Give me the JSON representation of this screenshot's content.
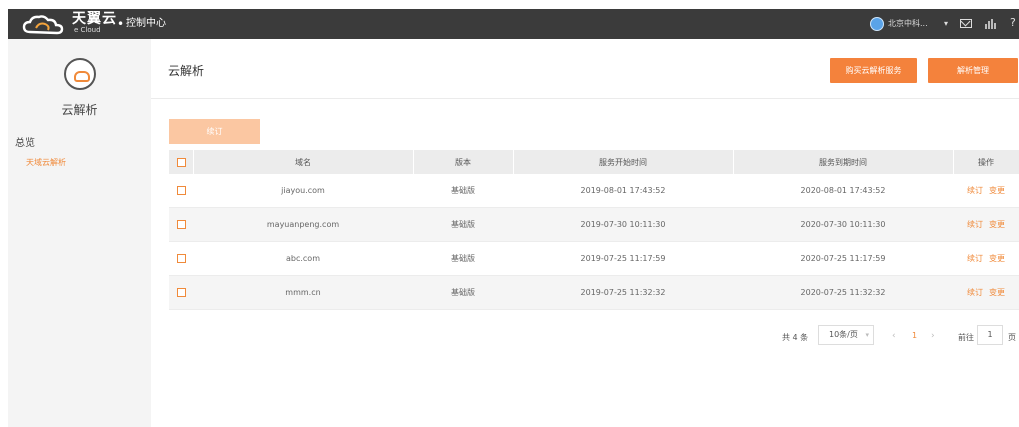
{
  "topbar": {
    "brand": "天翼云",
    "brand_sub": "e Cloud",
    "separator": "•",
    "console": "控制中心",
    "region": "北京中科...",
    "region_caret": "▾",
    "help": "?"
  },
  "sidebar": {
    "title": "云解析",
    "overview": "总览",
    "active_item": "天域云解析"
  },
  "main": {
    "title": "云解析",
    "buy_button": "购买云解析服务",
    "manage_button": "解析管理",
    "renew_button": "续订"
  },
  "table": {
    "headers": {
      "domain": "域名",
      "version": "版本",
      "start": "服务开始时间",
      "end": "服务到期时间",
      "ops": "操作"
    },
    "rows": [
      {
        "domain": "jiayou.com",
        "version": "基础版",
        "start": "2019-08-01 17:43:52",
        "end": "2020-08-01 17:43:52",
        "op_renew": "续订",
        "op_change": "变更"
      },
      {
        "domain": "mayuanpeng.com",
        "version": "基础版",
        "start": "2019-07-30 10:11:30",
        "end": "2020-07-30 10:11:30",
        "op_renew": "续订",
        "op_change": "变更"
      },
      {
        "domain": "abc.com",
        "version": "基础版",
        "start": "2019-07-25 11:17:59",
        "end": "2020-07-25 11:17:59",
        "op_renew": "续订",
        "op_change": "变更"
      },
      {
        "domain": "mmm.cn",
        "version": "基础版",
        "start": "2019-07-25 11:32:32",
        "end": "2020-07-25 11:32:32",
        "op_renew": "续订",
        "op_change": "变更"
      }
    ]
  },
  "pagination": {
    "total": "共 4 条",
    "page_size": "10条/页",
    "prev": "‹",
    "current": "1",
    "next": "›",
    "goto": "前往",
    "goto_value": "1",
    "page_suffix": "页"
  },
  "colors": {
    "accent": "#f4823c",
    "accent_light": "#fbc7a2",
    "topbar": "#3b3b3b",
    "sidebar": "#f4f4f4"
  }
}
